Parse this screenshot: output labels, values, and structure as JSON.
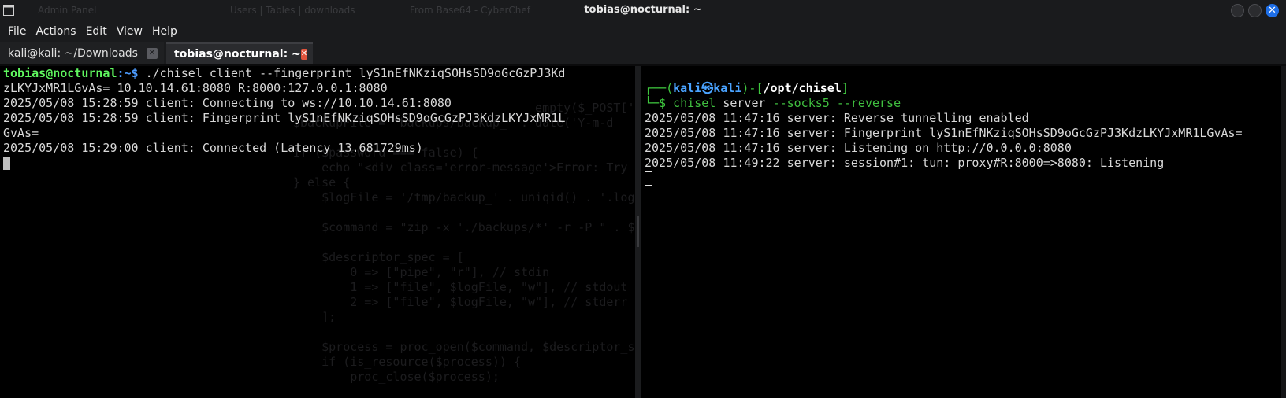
{
  "window": {
    "title": "tobias@nocturnal: ~",
    "ghost_tabs": [
      "Admin Panel",
      "Users | Tables | downloads",
      "From Base64 - CyberChef"
    ]
  },
  "menu": [
    "File",
    "Actions",
    "Edit",
    "View",
    "Help"
  ],
  "tabs": [
    {
      "label": "kali@kali: ~/Downloads",
      "close": "✕",
      "active": false
    },
    {
      "label": "tobias@nocturnal: ~",
      "close": "✕",
      "active": true
    }
  ],
  "left_terminal": {
    "prompt_user": "tobias@nocturnal",
    "prompt_sep": ":~$",
    "command": " ./chisel client --fingerprint lyS1nEfNKziqSOHsSD9oGcGzPJ3Kd",
    "command_wrap": "zLKYJxMR1LGvAs= 10.10.14.61:8080 R:8000:127.0.0.1:8080",
    "output": [
      "2025/05/08 15:28:59 client: Connecting to ws://10.10.14.61:8080",
      "2025/05/08 15:28:59 client: Fingerprint lyS1nEfNKziqSOHsSD9oGcGzPJ3KdzLKYJxMR1L",
      "GvAs=",
      "2025/05/08 15:29:00 client: Connected (Latency 13.681729ms)"
    ]
  },
  "right_terminal": {
    "prompt_top_open": "┌──(",
    "prompt_user": "kali",
    "prompt_at": "㉿",
    "prompt_host": "kali",
    "prompt_mid": ")-[",
    "prompt_path": "/opt/chisel",
    "prompt_close": "]",
    "prompt_bottom": "└─$ ",
    "cmd_name": "chisel",
    "cmd_sub": " server",
    "cmd_args": " --socks5 --reverse",
    "output": [
      "2025/05/08 11:47:16 server: Reverse tunnelling enabled",
      "2025/05/08 11:47:16 server: Fingerprint lyS1nEfNKziqSOHsSD9oGcGzPJ3KdzLKYJxMR1LGvAs=",
      "2025/05/08 11:47:16 server: Listening on http://0.0.0.0:8080",
      "2025/05/08 11:49:22 server: session#1: tun: proxy#R:8000=>8080: Listening"
    ]
  },
  "background_code": [
    "                                  empty($_POST['pass",
    "$backupFile = \"backups/backup_\" . date('Y-m-d",
    "",
    "if ($password === false) {",
    "    echo \"<div class='error-message'>Error: Try another password.</div>\";",
    "} else {",
    "    $logFile = '/tmp/backup_' . uniqid() . '.log';",
    "",
    "    $command = \"zip -x './backups/*' -r -P \" . $password . \" \" . $backupFile . \" . > \" . $logFile",
    "",
    "    $descriptor_spec = [",
    "        0 => [\"pipe\", \"r\"], // stdin",
    "        1 => [\"file\", $logFile, \"w\"], // stdout",
    "        2 => [\"file\", $logFile, \"w\"], // stderr",
    "    ];",
    "",
    "    $process = proc_open($command, $descriptor_spec, $pipes);",
    "    if (is_resource($process)) {",
    "        proc_close($process);"
  ]
}
